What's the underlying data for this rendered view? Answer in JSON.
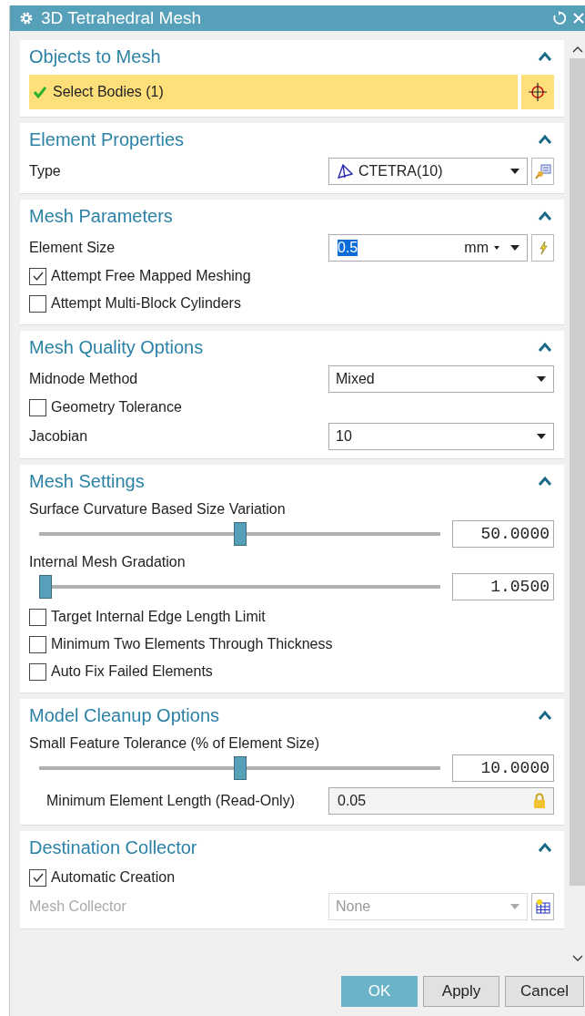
{
  "window": {
    "title": "3D Tetrahedral Mesh"
  },
  "sections": [
    {
      "title": "Objects to Mesh",
      "expanded": true,
      "rows": [
        {
          "kind": "selection",
          "label": "Select Bodies (1)",
          "complete": true
        }
      ]
    },
    {
      "title": "Element Properties",
      "expanded": true,
      "rows": [
        {
          "kind": "element-type",
          "label": "Type",
          "value": "CTETRA(10)",
          "accessory": {
            "kind": "properties"
          }
        }
      ]
    },
    {
      "title": "Mesh Parameters",
      "expanded": true,
      "rows": [
        {
          "kind": "unit-field",
          "label": "Element Size",
          "value": "0.5",
          "value_selected": true,
          "unit": "mm",
          "accessory": {
            "kind": "infer"
          }
        },
        {
          "kind": "checkbox",
          "label": "Attempt Free Mapped Meshing",
          "checked": true
        },
        {
          "kind": "checkbox",
          "label": "Attempt Multi-Block Cylinders",
          "checked": false
        }
      ]
    },
    {
      "title": "Mesh Quality Options",
      "expanded": true,
      "rows": [
        {
          "kind": "dropdown",
          "label": "Midnode Method",
          "value": "Mixed",
          "disabled": false
        },
        {
          "kind": "checkbox",
          "label": "Geometry Tolerance",
          "checked": false
        },
        {
          "kind": "dropdown",
          "label": "Jacobian",
          "value": "10",
          "disabled": false
        }
      ]
    },
    {
      "title": "Mesh Settings",
      "expanded": true,
      "rows": [
        {
          "kind": "slider",
          "label": "Surface Curvature Based Size Variation",
          "level": 0.5,
          "reading": "50.0000"
        },
        {
          "kind": "slider",
          "label": "Internal Mesh Gradation",
          "level": 0.0,
          "reading": "1.0500"
        },
        {
          "kind": "checkbox",
          "label": "Target Internal Edge Length Limit",
          "checked": false
        },
        {
          "kind": "checkbox",
          "label": "Minimum Two Elements Through Thickness",
          "checked": false
        },
        {
          "kind": "checkbox",
          "label": "Auto Fix Failed Elements",
          "checked": false
        }
      ]
    },
    {
      "title": "Model Cleanup Options",
      "expanded": true,
      "rows": [
        {
          "kind": "slider",
          "label": "Small Feature Tolerance (% of Element Size)",
          "level": 0.5,
          "reading": "10.0000"
        },
        {
          "kind": "readonly",
          "label": "Minimum Element Length (Read-Only)",
          "value": "0.05"
        }
      ]
    },
    {
      "title": "Destination Collector",
      "expanded": true,
      "rows": [
        {
          "kind": "checkbox",
          "label": "Automatic Creation",
          "checked": true
        },
        {
          "kind": "dropdown",
          "label": "Mesh Collector",
          "value": "None",
          "disabled": true,
          "accessory": {
            "kind": "create"
          }
        }
      ]
    }
  ],
  "buttons": [
    {
      "label": "OK",
      "default": true
    },
    {
      "label": "Apply",
      "default": false
    },
    {
      "label": "Cancel",
      "default": false
    }
  ]
}
